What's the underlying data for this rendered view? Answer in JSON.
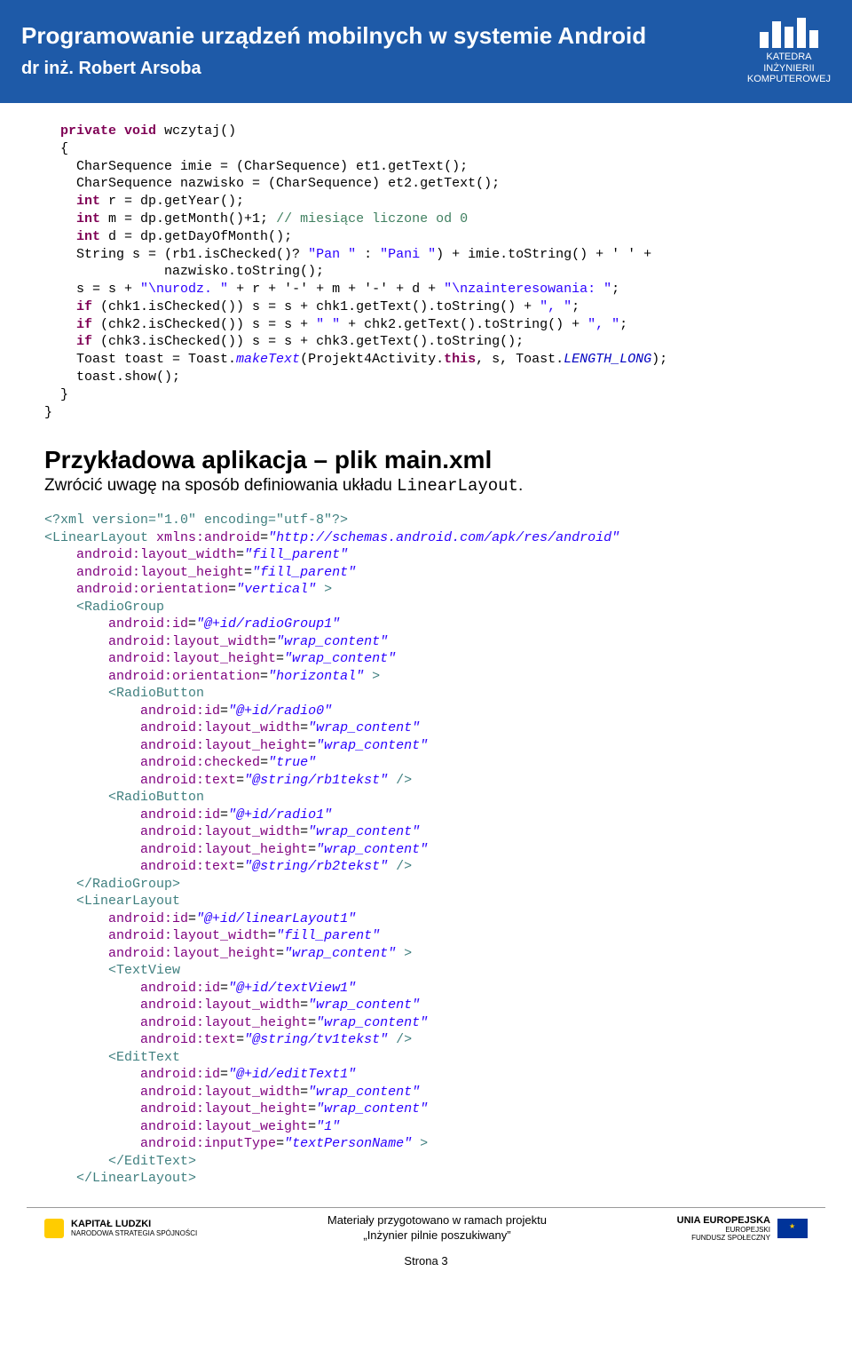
{
  "header": {
    "title": "Programowanie urządzeń mobilnych w systemie Android",
    "author": "dr inż. Robert Arsoba",
    "logo_line1": "KATEDRA",
    "logo_line2": "INŻYNIERII",
    "logo_line3": "KOMPUTEROWEJ"
  },
  "code1": {
    "l1a": "private",
    "l1b": "void",
    "l1c": " wczytaj()",
    "l2": "{",
    "l3a": "    CharSequence imie = (CharSequence) et1.getText();",
    "l4a": "    CharSequence nazwisko = (CharSequence) et2.getText();",
    "l5a": "    ",
    "l5b": "int",
    "l5c": " r = dp.getYear();",
    "l6a": "    ",
    "l6b": "int",
    "l6c": " m = dp.getMonth()+1; ",
    "l6d": "// miesiące liczone od 0",
    "l7a": "    ",
    "l7b": "int",
    "l7c": " d = dp.getDayOfMonth();",
    "l8a": "    String s = (rb1.isChecked()? ",
    "l8b": "\"Pan \"",
    "l8c": " : ",
    "l8d": "\"Pani \"",
    "l8e": ") + imie.toString() + ' ' +",
    "l9a": "               nazwisko.toString();",
    "l10a": "    s = s + ",
    "l10b": "\"\\nurodz. \"",
    "l10c": " + r + '-' + m + '-' + d + ",
    "l10d": "\"\\nzainteresowania: \"",
    "l10e": ";",
    "l11a": "    ",
    "l11b": "if",
    "l11c": " (chk1.isChecked()) s = s + chk1.getText().toString() + ",
    "l11d": "\", \"",
    "l11e": ";",
    "l12a": "    ",
    "l12b": "if",
    "l12c": " (chk2.isChecked()) s = s + ",
    "l12d": "\" \"",
    "l12e": " + chk2.getText().toString() + ",
    "l12f": "\", \"",
    "l12g": ";",
    "l13a": "    ",
    "l13b": "if",
    "l13c": " (chk3.isChecked()) s = s + chk3.getText().toString();",
    "l14a": "    Toast toast = Toast.",
    "l14b": "makeText",
    "l14c": "(Projekt4Activity.",
    "l14d": "this",
    "l14e": ", s, Toast.",
    "l14f": "LENGTH_LONG",
    "l14g": ");",
    "l15": "    toast.show();",
    "l16": "  }",
    "l17": "}"
  },
  "section": {
    "title": "Przykładowa aplikacja – plik main.xml",
    "sub_a": "Zwrócić uwagę na sposób definiowania układu ",
    "sub_b": "LinearLayout",
    "sub_c": "."
  },
  "xml": {
    "decl": "<?xml version=\"1.0\" encoding=\"utf-8\"?>",
    "l2a": "<LinearLayout ",
    "l2b": "xmlns:android",
    "l2c": "=",
    "l2v": "\"http://schemas.android.com/apk/res/android\"",
    "l3a": "    ",
    "l3b": "android:layout_width",
    "l3v": "\"fill_parent\"",
    "l4a": "    ",
    "l4b": "android:layout_height",
    "l4v": "\"fill_parent\"",
    "l5a": "    ",
    "l5b": "android:orientation",
    "l5v": "\"vertical\"",
    "l5e": " >",
    "l6a": "    <RadioGroup",
    "l7a": "        ",
    "l7b": "android:id",
    "l7v": "\"@+id/radioGroup1\"",
    "l8a": "        ",
    "l8b": "android:layout_width",
    "l8v": "\"wrap_content\"",
    "l9a": "        ",
    "l9b": "android:layout_height",
    "l9v": "\"wrap_content\"",
    "l10a": "        ",
    "l10b": "android:orientation",
    "l10v": "\"horizontal\"",
    "l10e": " >",
    "l11a": "        <RadioButton",
    "l12a": "            ",
    "l12b": "android:id",
    "l12v": "\"@+id/radio0\"",
    "l13a": "            ",
    "l13b": "android:layout_width",
    "l13v": "\"wrap_content\"",
    "l14a": "            ",
    "l14b": "android:layout_height",
    "l14v": "\"wrap_content\"",
    "l15a": "            ",
    "l15b": "android:checked",
    "l15v": "\"true\"",
    "l16a": "            ",
    "l16b": "android:text",
    "l16v": "\"@string/rb1tekst\"",
    "l16e": " />",
    "l17a": "        <RadioButton",
    "l18a": "            ",
    "l18b": "android:id",
    "l18v": "\"@+id/radio1\"",
    "l19a": "            ",
    "l19b": "android:layout_width",
    "l19v": "\"wrap_content\"",
    "l20a": "            ",
    "l20b": "android:layout_height",
    "l20v": "\"wrap_content\"",
    "l21a": "            ",
    "l21b": "android:text",
    "l21v": "\"@string/rb2tekst\"",
    "l21e": " />",
    "l22": "    </RadioGroup>",
    "l23a": "    <LinearLayout",
    "l24a": "        ",
    "l24b": "android:id",
    "l24v": "\"@+id/linearLayout1\"",
    "l25a": "        ",
    "l25b": "android:layout_width",
    "l25v": "\"fill_parent\"",
    "l26a": "        ",
    "l26b": "android:layout_height",
    "l26v": "\"wrap_content\"",
    "l26e": " >",
    "l27a": "        <TextView",
    "l28a": "            ",
    "l28b": "android:id",
    "l28v": "\"@+id/textView1\"",
    "l29a": "            ",
    "l29b": "android:layout_width",
    "l29v": "\"wrap_content\"",
    "l30a": "            ",
    "l30b": "android:layout_height",
    "l30v": "\"wrap_content\"",
    "l31a": "            ",
    "l31b": "android:text",
    "l31v": "\"@string/tv1tekst\"",
    "l31e": " />",
    "l32a": "        <EditText",
    "l33a": "            ",
    "l33b": "android:id",
    "l33v": "\"@+id/editText1\"",
    "l34a": "            ",
    "l34b": "android:layout_width",
    "l34v": "\"wrap_content\"",
    "l35a": "            ",
    "l35b": "android:layout_height",
    "l35v": "\"wrap_content\"",
    "l36a": "            ",
    "l36b": "android:layout_weight",
    "l36v": "\"1\"",
    "l37a": "            ",
    "l37b": "android:inputType",
    "l37v": "\"textPersonName\"",
    "l37e": " >",
    "l38": "        </EditText>",
    "l39": "    </LinearLayout>"
  },
  "footer": {
    "left": "KAPITAŁ LUDZKI",
    "left_sub": "NARODOWA STRATEGIA SPÓJNOŚCI",
    "center1": "Materiały przygotowano w ramach projektu",
    "center2": "„Inżynier pilnie poszukiwany”",
    "right1": "UNIA EUROPEJSKA",
    "right2": "EUROPEJSKI",
    "right3": "FUNDUSZ SPOŁECZNY",
    "page": "Strona 3"
  }
}
